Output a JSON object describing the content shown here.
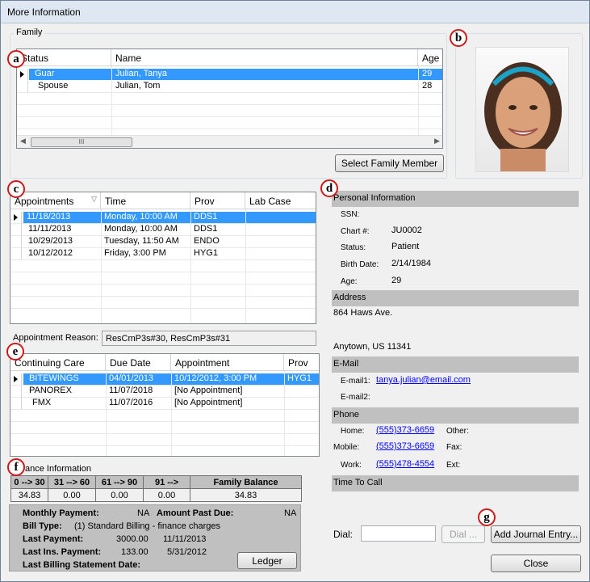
{
  "window": {
    "title": "More Information"
  },
  "family": {
    "group_label": "Family",
    "columns": [
      "Status",
      "Name",
      "Age"
    ],
    "rows": [
      {
        "status": "Guar",
        "name": "Julian, Tanya",
        "age": "29"
      },
      {
        "status": "Spouse",
        "name": "Julian, Tom",
        "age": "28"
      }
    ],
    "select_button": "Select Family Member",
    "scroll_grip": "III"
  },
  "appointments": {
    "columns": [
      "Appointments",
      "Time",
      "Prov",
      "Lab Case"
    ],
    "rows": [
      {
        "date": "11/18/2013",
        "time": "Monday, 10:00 AM",
        "prov": "DDS1",
        "lab": ""
      },
      {
        "date": "11/11/2013",
        "time": "Monday, 10:00 AM",
        "prov": "DDS1",
        "lab": ""
      },
      {
        "date": "10/29/2013",
        "time": "Tuesday, 11:50 AM",
        "prov": "ENDO",
        "lab": ""
      },
      {
        "date": "10/12/2012",
        "time": "Friday, 3:00 PM",
        "prov": "HYG1",
        "lab": ""
      }
    ],
    "reason_label": "Appointment Reason:",
    "reason_value": "ResCmP3s#30, ResCmP3s#31"
  },
  "recall": {
    "columns": [
      "Continuing Care",
      "Due Date",
      "Appointment",
      "Prov"
    ],
    "rows": [
      {
        "type": "BITEWINGS",
        "due": "04/01/2013",
        "appt": "10/12/2012, 3:00 PM",
        "prov": "HYG1"
      },
      {
        "type": "PANOREX",
        "due": "11/07/2018",
        "appt": "[No Appointment]",
        "prov": ""
      },
      {
        "type": "FMX",
        "due": "11/07/2016",
        "appt": "[No Appointment]",
        "prov": ""
      }
    ]
  },
  "balance": {
    "label": "ance Information",
    "aging_headers": [
      "0 --> 30",
      "31 --> 60",
      "61 --> 90",
      "91 -->",
      "Family Balance"
    ],
    "aging_values": [
      "34.83",
      "0.00",
      "0.00",
      "0.00",
      "34.83"
    ],
    "monthly_payment_label": "Monthly Payment:",
    "monthly_payment": "NA",
    "past_due_label": "Amount Past Due:",
    "past_due": "NA",
    "bill_type_label": "Bill Type:",
    "bill_type": "(1) Standard Billing - finance charges",
    "last_payment_label": "Last Payment:",
    "last_payment_amount": "3000.00",
    "last_payment_date": "11/11/2013",
    "last_ins_label": "Last Ins. Payment:",
    "last_ins_amount": "133.00",
    "last_ins_date": "5/31/2012",
    "last_stmt_label": "Last Billing Statement Date:",
    "ledger_button": "Ledger"
  },
  "personal": {
    "header": "Personal Information",
    "ssn_label": "SSN:",
    "ssn": "",
    "chart_label": "Chart #:",
    "chart": "JU0002",
    "status_label": "Status:",
    "status": "Patient",
    "birth_label": "Birth Date:",
    "birth": "2/14/1984",
    "age_label": "Age:",
    "age": "29",
    "address_header": "Address",
    "address1": "864 Haws Ave.",
    "address2": "Anytown, US 11341",
    "email_header": "E-Mail",
    "email1_label": "E-mail1:",
    "email1": "tanya.julian@email.com",
    "email2_label": "E-mail2:",
    "phone_header": "Phone",
    "home_label": "Home:",
    "home": "(555)373-6659",
    "other_label": "Other:",
    "mobile_label": "Mobile:",
    "mobile": "(555)373-6659",
    "fax_label": "Fax:",
    "work_label": "Work:",
    "work": "(555)478-4554",
    "ext_label": "Ext:",
    "call_header": "Time To Call"
  },
  "footer": {
    "dial_label": "Dial:",
    "dial_button": "Dial ...",
    "journal_button": "Add Journal Entry...",
    "close_button": "Close"
  },
  "markers": [
    "a",
    "b",
    "c",
    "d",
    "e",
    "f",
    "g"
  ],
  "colors": {
    "selection": "#3399ff",
    "marker": "#d01818",
    "section_bar": "#c0c0c0",
    "link": "#0000ff"
  }
}
